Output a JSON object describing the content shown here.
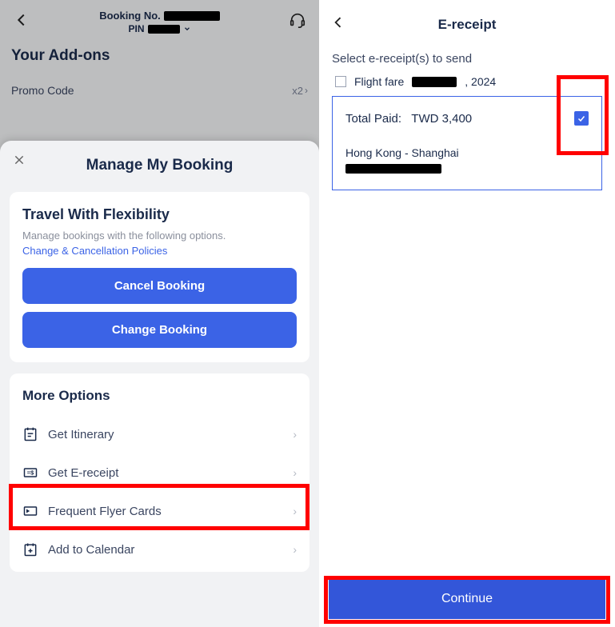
{
  "left": {
    "header": {
      "booking_no_label": "Booking No.",
      "pin_label": "PIN"
    },
    "addons": {
      "title": "Your Add-ons",
      "promo_label": "Promo Code",
      "promo_qty": "x2"
    },
    "sheet": {
      "title": "Manage My Booking",
      "flex_card": {
        "title": "Travel With Flexibility",
        "subtitle": "Manage bookings with the following options.",
        "link": "Change & Cancellation Policies",
        "cancel_btn": "Cancel Booking",
        "change_btn": "Change Booking"
      },
      "more": {
        "title": "More Options",
        "itinerary": "Get Itinerary",
        "e_receipt": "Get E-receipt",
        "ff_cards": "Frequent Flyer Cards",
        "calendar": "Add to Calendar"
      }
    }
  },
  "right": {
    "title": "E-receipt",
    "subtitle": "Select e-receipt(s) to send",
    "flight_fare_label": "Flight fare",
    "flight_fare_year": ", 2024",
    "receipt": {
      "total_paid_label": "Total Paid:",
      "total_paid_value": "TWD 3,400",
      "route": "Hong Kong - Shanghai"
    },
    "continue_btn": "Continue"
  }
}
